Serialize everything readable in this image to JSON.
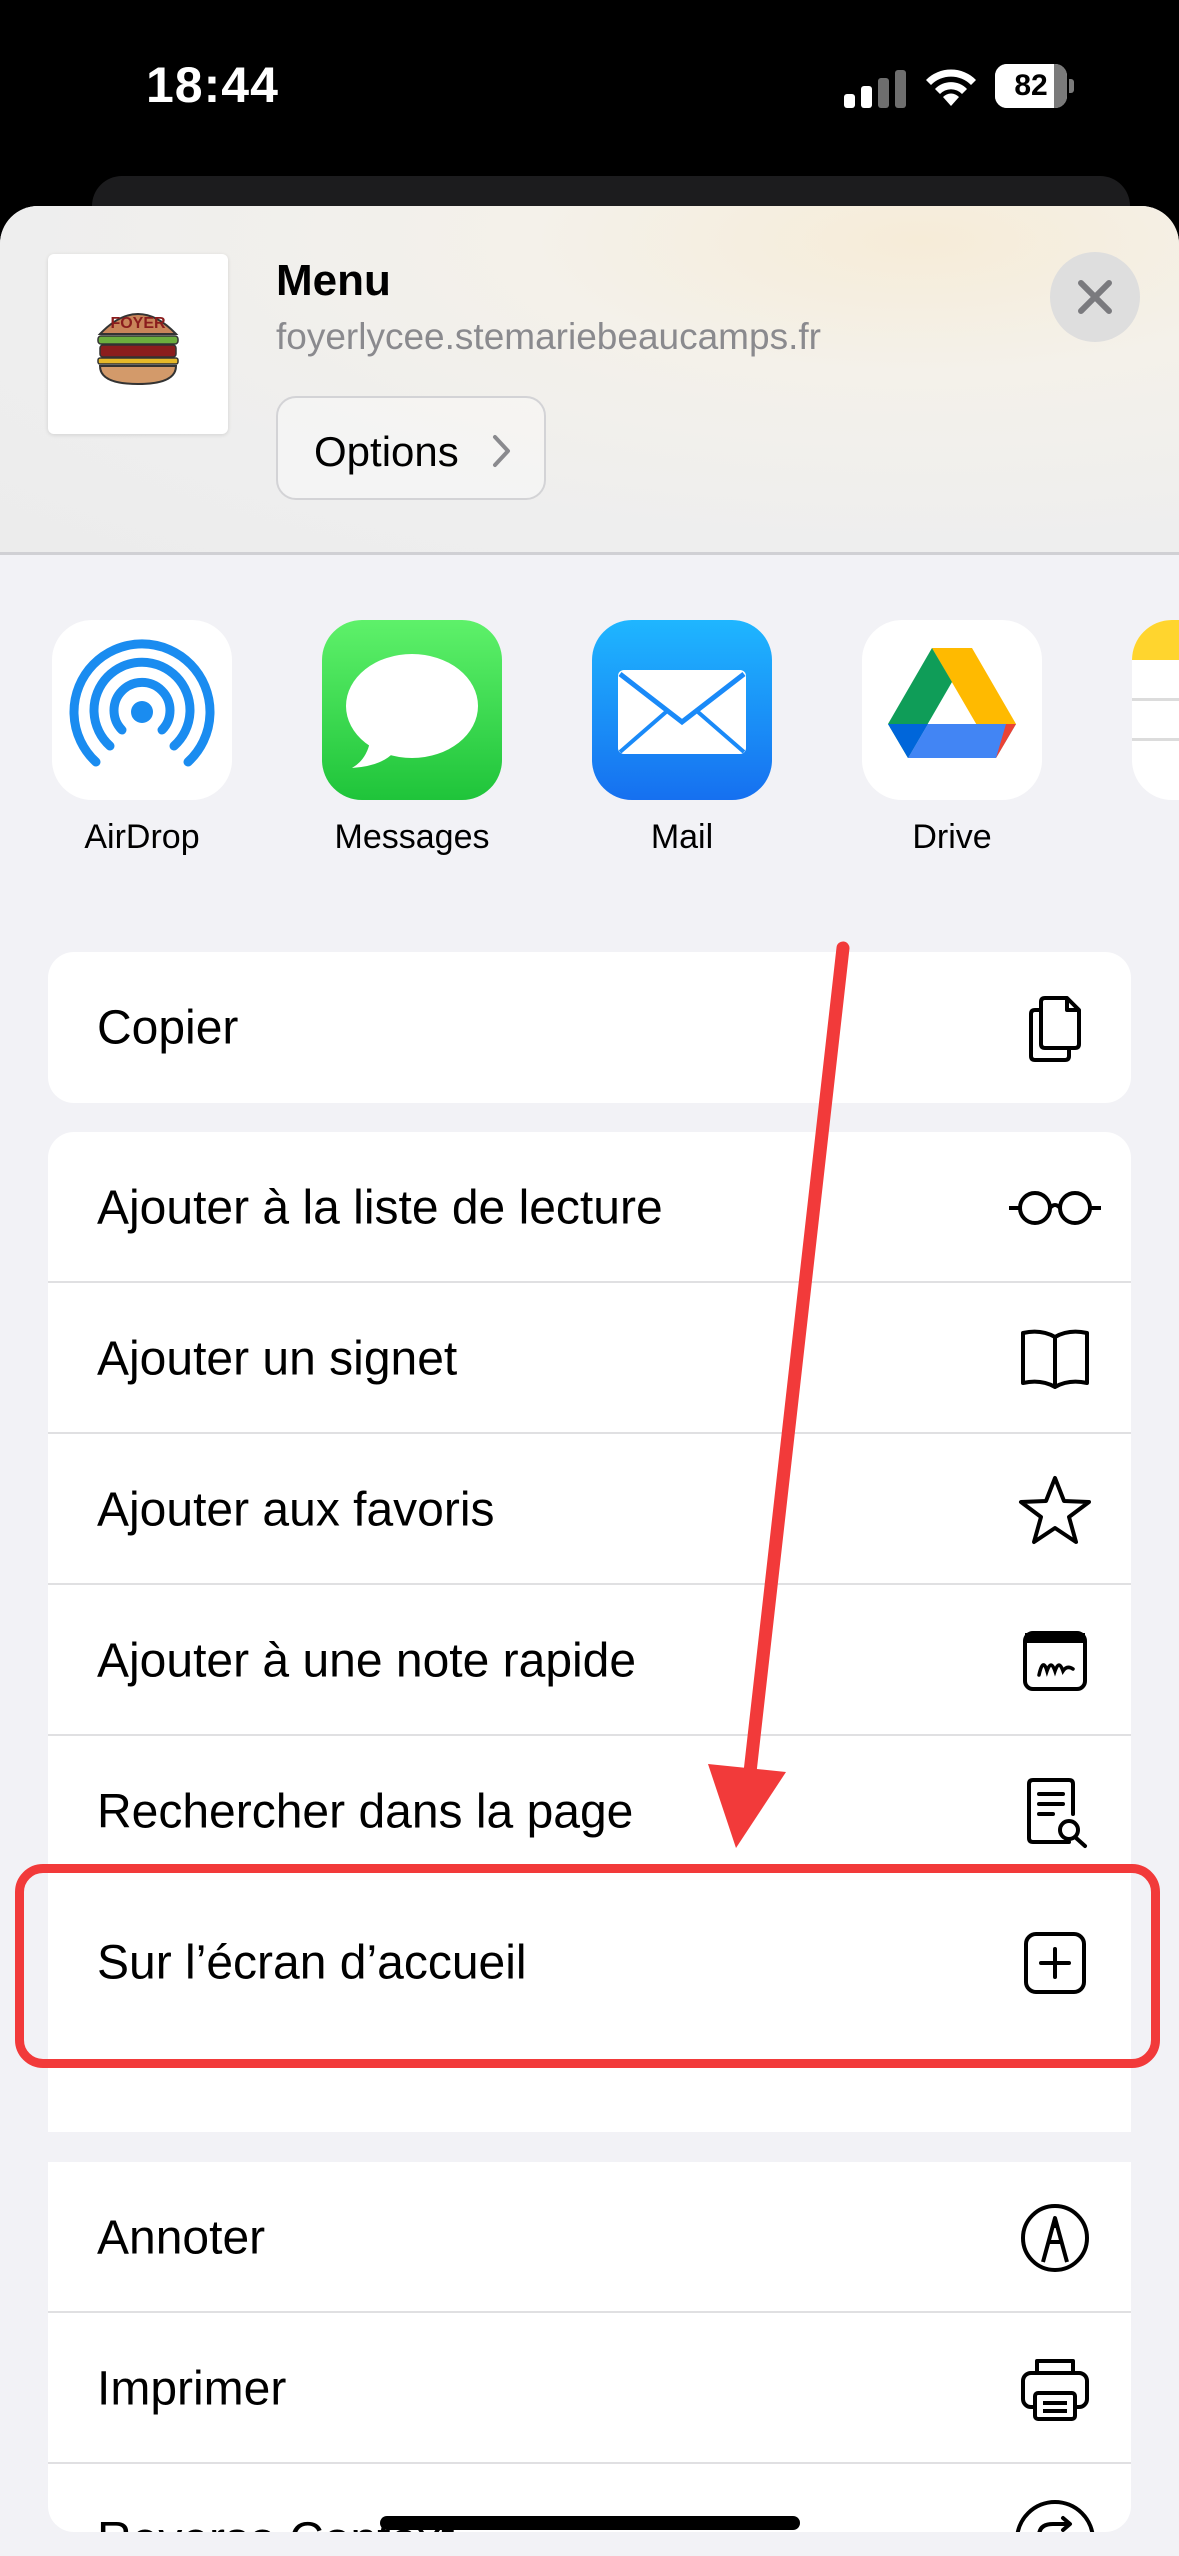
{
  "status_bar": {
    "time": "18:44",
    "battery": "82"
  },
  "header": {
    "title": "Menu",
    "url": "foyerlycee.stemariebeaucamps.fr",
    "options_label": "Options",
    "thumbnail_text": "FOYER"
  },
  "apps": [
    {
      "name": "AirDrop",
      "icon": "airdrop-icon"
    },
    {
      "name": "Messages",
      "icon": "messages-icon"
    },
    {
      "name": "Mail",
      "icon": "mail-icon"
    },
    {
      "name": "Drive",
      "icon": "google-drive-icon"
    }
  ],
  "actions": {
    "copy": "Copier",
    "reading_list": "Ajouter à la liste de lecture",
    "bookmark": "Ajouter un signet",
    "favorites": "Ajouter aux favoris",
    "quick_note": "Ajouter à une note rapide",
    "find_in_page": "Rechercher dans la page",
    "home_screen": "Sur l’écran d’accueil",
    "markup": "Annoter",
    "print": "Imprimer",
    "reverso": "Reverso Context"
  },
  "colors": {
    "annotation_red": "#f23a3a",
    "sheet_bg": "#f2f2f6"
  }
}
